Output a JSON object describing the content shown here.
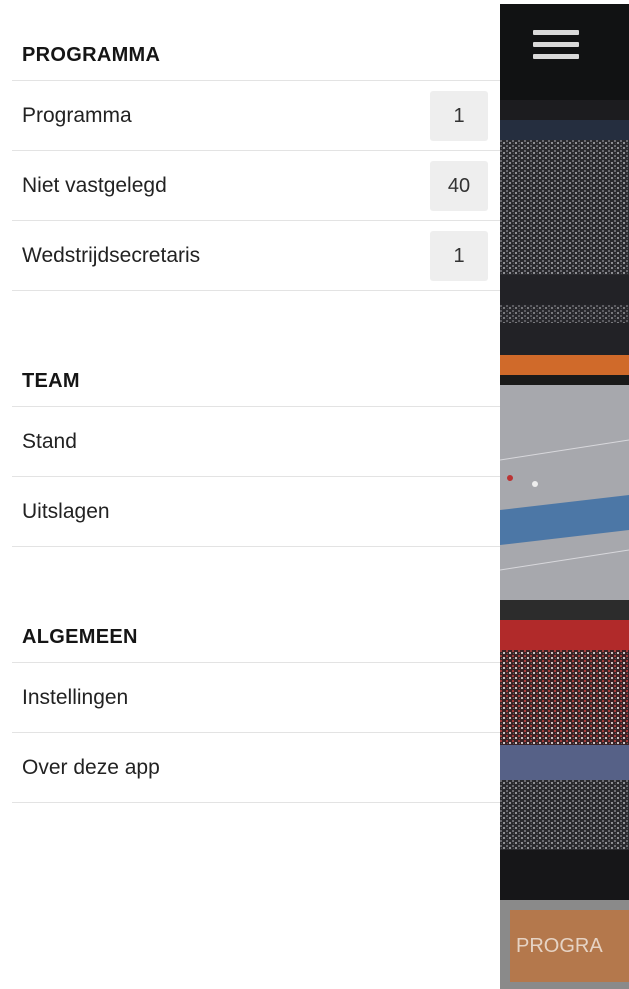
{
  "menu": {
    "sections": [
      {
        "title": "PROGRAMMA",
        "items": [
          {
            "label": "Programma",
            "count": "1"
          },
          {
            "label": "Niet vastgelegd",
            "count": "40"
          },
          {
            "label": "Wedstrijdsecretaris",
            "count": "1"
          }
        ]
      },
      {
        "title": "TEAM",
        "items": [
          {
            "label": "Stand"
          },
          {
            "label": "Uitslagen"
          }
        ]
      },
      {
        "title": "ALGEMEEN",
        "items": [
          {
            "label": "Instellingen"
          },
          {
            "label": "Over deze app"
          }
        ]
      }
    ]
  },
  "main": {
    "menu_icon": "hamburger-icon",
    "bottom_button_label": "PROGRA",
    "colors": {
      "bottom_button": "#b4784c",
      "court": "#a9aab0",
      "court_border": "#e0702a"
    }
  }
}
